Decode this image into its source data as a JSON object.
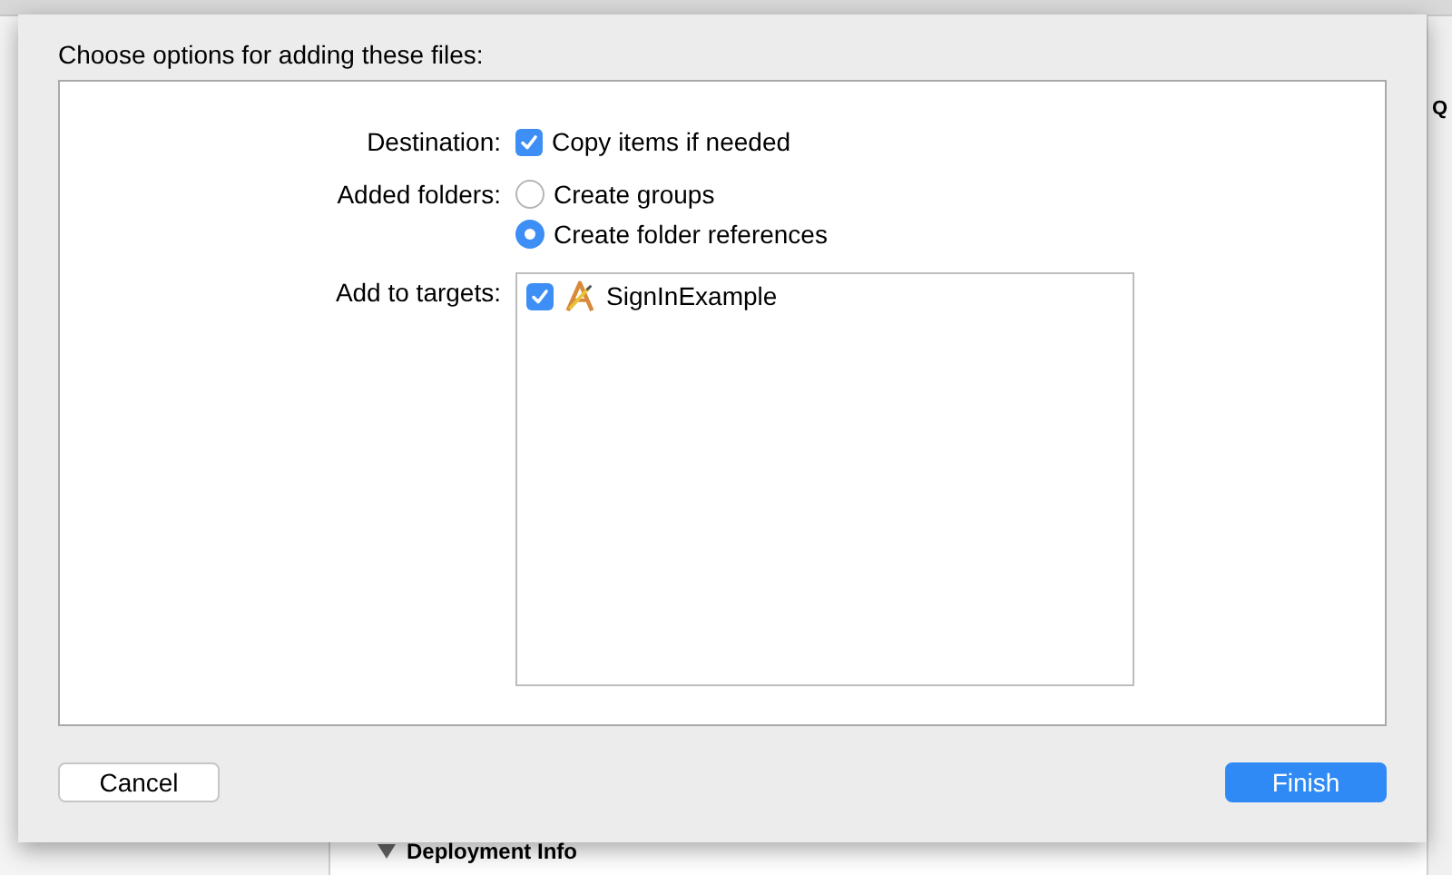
{
  "background": {
    "side_letter": "Q",
    "section": {
      "title": "Deployment Info",
      "expanded": true
    }
  },
  "sheet": {
    "title": "Choose options for adding these files:",
    "destination": {
      "label": "Destination:",
      "option": {
        "label": "Copy items if needed",
        "checked": true
      }
    },
    "added_folders": {
      "label": "Added folders:",
      "options": [
        {
          "label": "Create groups",
          "selected": false
        },
        {
          "label": "Create folder references",
          "selected": true
        }
      ]
    },
    "targets": {
      "label": "Add to targets:",
      "items": [
        {
          "label": "SignInExample",
          "checked": true
        }
      ]
    },
    "buttons": [
      {
        "label": "Cancel",
        "kind": "secondary"
      },
      {
        "label": "Finish",
        "kind": "primary"
      }
    ]
  }
}
